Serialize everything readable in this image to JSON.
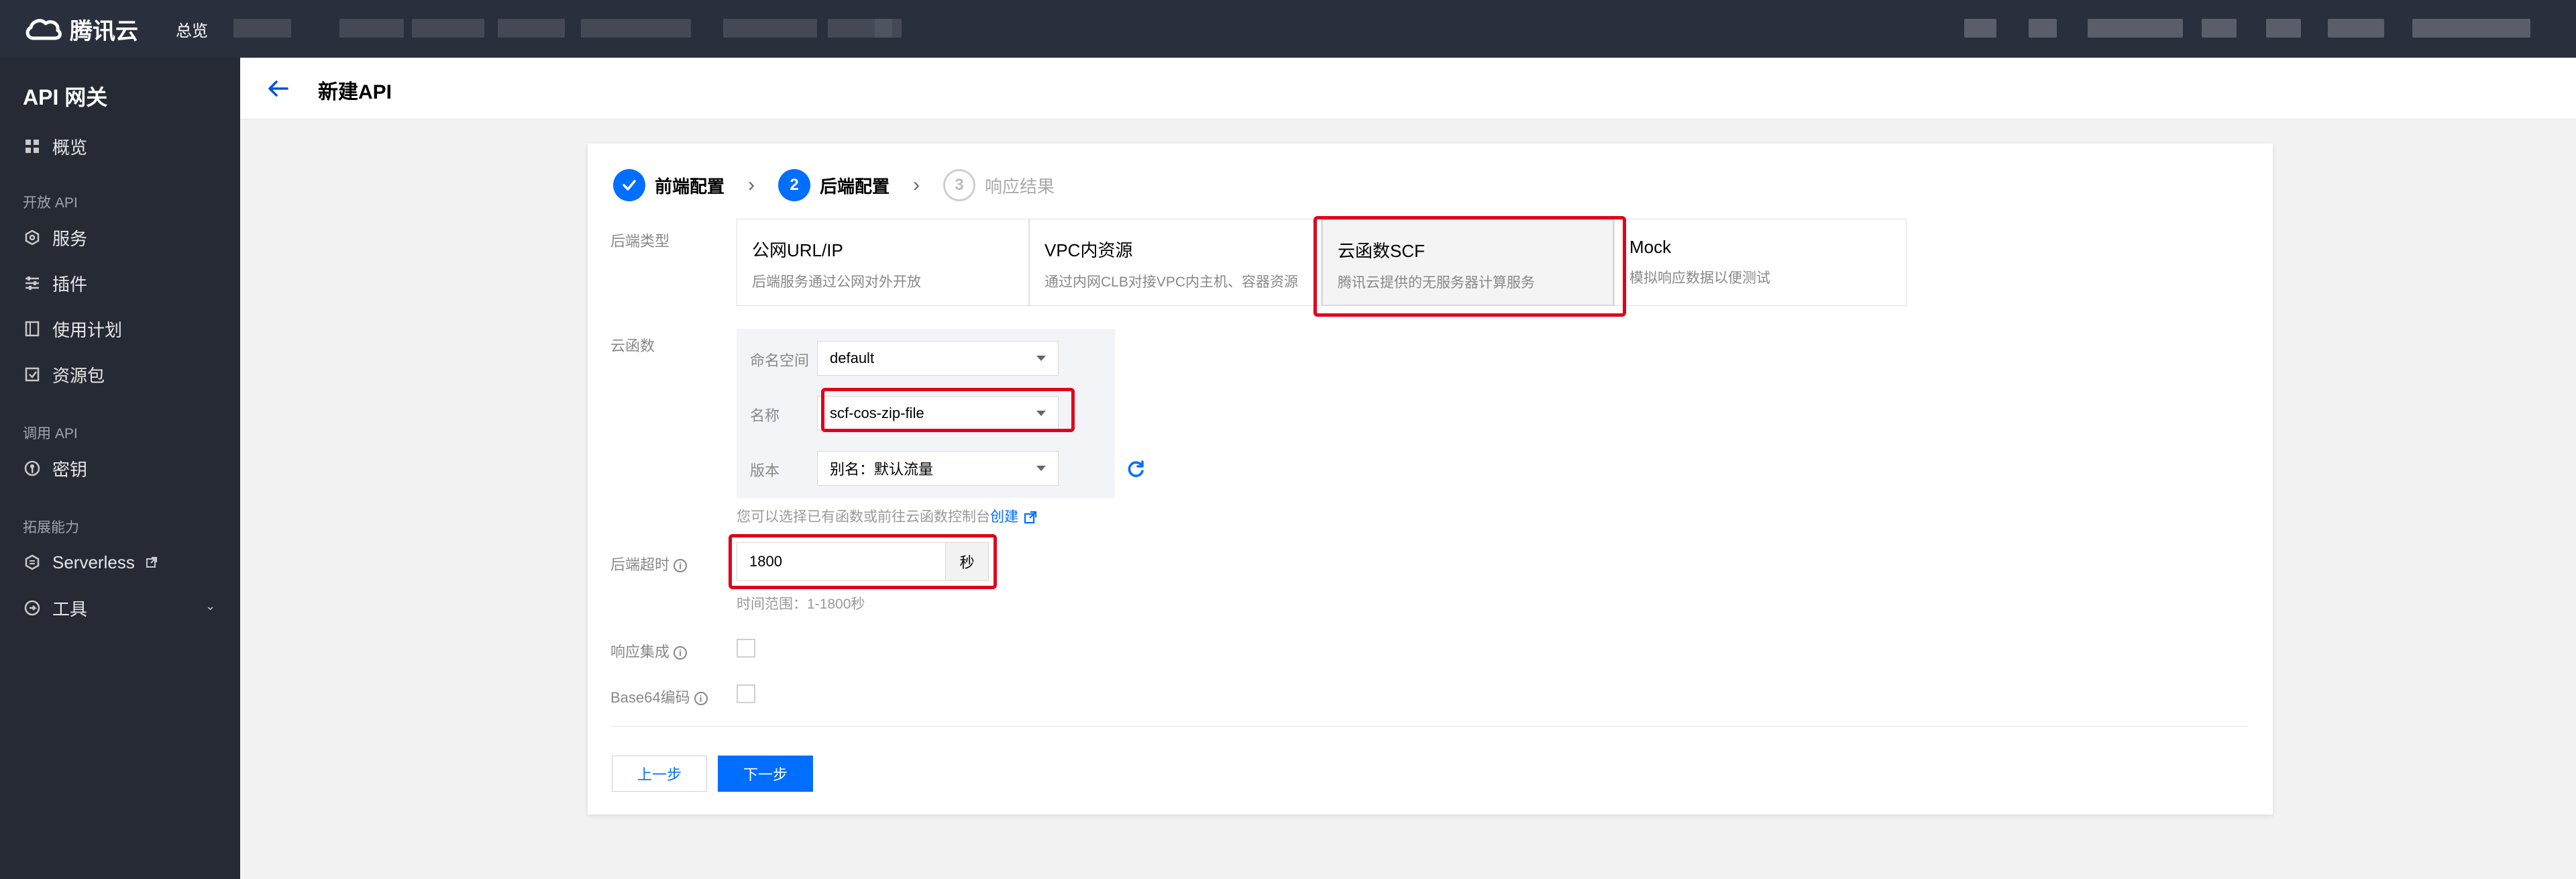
{
  "app": {
    "brand": "腾讯云",
    "nav_overview": "总览"
  },
  "sidebar": {
    "title": "API 网关",
    "items": [
      {
        "label": "概览",
        "icon": "grid-icon"
      },
      {
        "group": "开放 API"
      },
      {
        "label": "服务",
        "icon": "cube-icon"
      },
      {
        "label": "插件",
        "icon": "sliders-icon"
      },
      {
        "label": "使用计划",
        "icon": "document-icon"
      },
      {
        "label": "资源包",
        "icon": "package-icon"
      },
      {
        "group": "调用 API"
      },
      {
        "label": "密钥",
        "icon": "key-icon"
      },
      {
        "group": "拓展能力"
      },
      {
        "label": "Serverless",
        "icon": "serverless-icon",
        "external": true
      },
      {
        "label": "工具",
        "icon": "tools-icon",
        "expandable": true
      }
    ]
  },
  "header": {
    "title": "新建API"
  },
  "steps": [
    {
      "num": "1",
      "label": "前端配置",
      "state": "done"
    },
    {
      "num": "2",
      "label": "后端配置",
      "state": "active"
    },
    {
      "num": "3",
      "label": "响应结果",
      "state": "pending"
    }
  ],
  "form": {
    "backend_type_label": "后端类型",
    "backend_types": [
      {
        "title": "公网URL/IP",
        "desc": "后端服务通过公网对外开放"
      },
      {
        "title": "VPC内资源",
        "desc": "通过内网CLB对接VPC内主机、容器资源"
      },
      {
        "title": "云函数SCF",
        "desc": "腾讯云提供的无服务器计算服务",
        "selected": true
      },
      {
        "title": "Mock",
        "desc": "模拟响应数据以便测试"
      }
    ],
    "function_label": "云函数",
    "namespace_label": "命名空间",
    "namespace_value": "default",
    "name_label": "名称",
    "name_value": "scf-cos-zip-file",
    "version_label": "版本",
    "version_value": "别名：默认流量",
    "function_hint": "您可以选择已有函数或前往云函数控制台",
    "function_hint_link": "创建",
    "timeout_label": "后端超时",
    "timeout_value": "1800",
    "timeout_unit": "秒",
    "timeout_hint": "时间范围：1-1800秒",
    "response_integration_label": "响应集成",
    "base64_label": "Base64编码"
  },
  "buttons": {
    "prev": "上一步",
    "next": "下一步"
  },
  "colors": {
    "primary": "#006eff",
    "topbar": "#2a2f3d",
    "sidebar": "#252a35",
    "highlight": "#e0001a"
  }
}
